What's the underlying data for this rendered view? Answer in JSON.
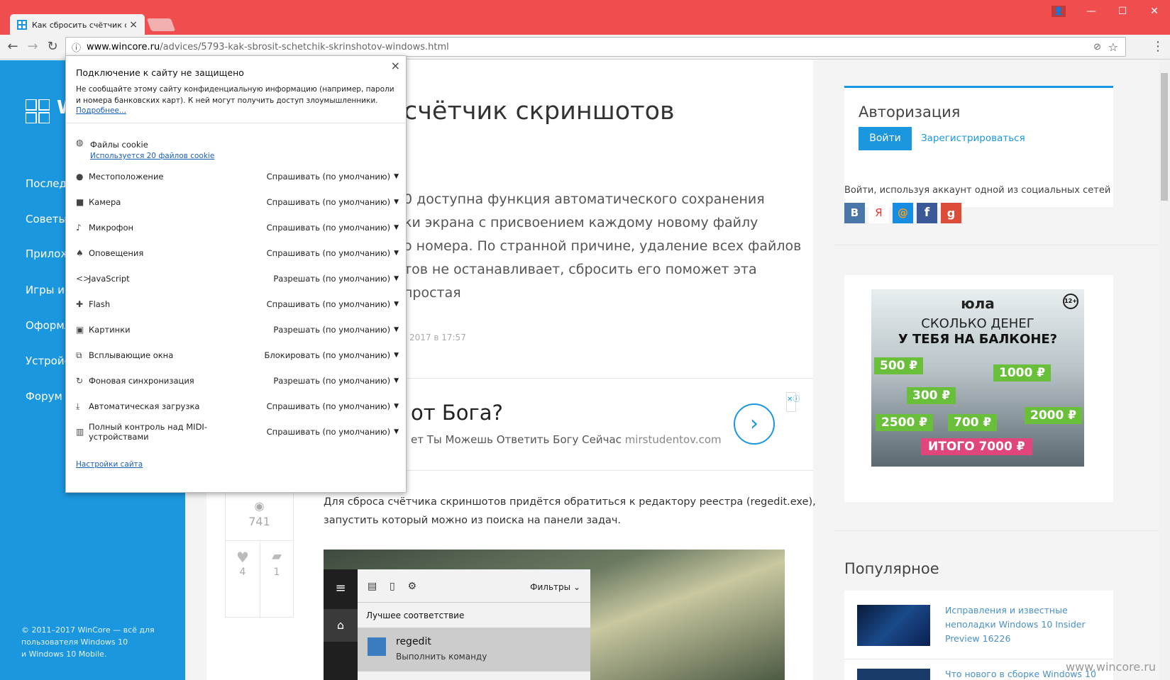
{
  "browser": {
    "tab_title": "Как сбросить счётчик с",
    "tab_close": "×",
    "url_domain": "www.wincore.ru",
    "url_path": "/advices/5793-kak-sbrosit-schetchik-skrinshotov-windows.html",
    "back": "←",
    "forward": "→",
    "reload": "↻",
    "info": "ⓘ",
    "star": "☆",
    "menu": "⋮",
    "min": "—",
    "max": "☐",
    "close": "✕",
    "user": "👤",
    "ext": "⊘"
  },
  "sidebar": {
    "logo_letter": "W",
    "items": [
      "Последн",
      "Советы и",
      "Приложе",
      "Игры и р",
      "Оформл",
      "Устройс",
      "Форум о"
    ],
    "footer": [
      "© 2011–2017 WinCore — всё для",
      "пользователя Windows 10",
      "и Windows 10 Mobile."
    ]
  },
  "article": {
    "title": "счётчик скриншотов",
    "lead": [
      "0 доступна функция автоматического сохранения",
      "ки экрана с присвоением каждому новому файлу",
      "о номера. По странной причине, удаление всех файлов",
      "тов не останавливает, сбросить его поможет эта простая"
    ],
    "date": "2017 в 17:57",
    "ad_title": "от Бога?",
    "ad_text": "ет Ты Можешь Ответить Богу Сейчас",
    "ad_domain": "mirstudentov.com",
    "views": "741",
    "likes": "4",
    "comments": "1",
    "body": [
      "Для сброса счётчика скриншотов придётся обратиться к редактору реестра (regedit.exe),",
      "запустить который можно из поиска на панели задач."
    ],
    "search_filters": "Фильтры",
    "search_best": "Лучшее соответствие",
    "search_app": "regedit",
    "search_app_sub": "Выполнить команду"
  },
  "right": {
    "auth_title": "Авторизация",
    "login_btn": "Войти",
    "register_link": "Зарегистрироваться",
    "social_text": "Войти, используя аккаунт одной из социальных сетей",
    "socials": [
      {
        "l": "В",
        "c": "#4a76a8"
      },
      {
        "l": "Я",
        "c": "#fff"
      },
      {
        "l": "@",
        "c": "#168de2"
      },
      {
        "l": "f",
        "c": "#3b5998"
      },
      {
        "l": "g",
        "c": "#dd4b39"
      }
    ],
    "ad_brand": "юла",
    "ad_line1": "СКОЛЬКО ДЕНЕГ",
    "ad_line2": "У ТЕБЯ НА БАЛКОНЕ?",
    "ad_prices": [
      "500 ₽",
      "1000 ₽",
      "300 ₽",
      "2000 ₽",
      "2500 ₽",
      "700 ₽"
    ],
    "ad_total": "ИТОГО 7000 ₽",
    "ad_age": "12+",
    "popular_title": "Популярное",
    "popular_items": [
      "Исправления и известные",
      "неполадки Windows 10 Insider",
      "Preview 16226"
    ],
    "popular_next": "Что нового в сборке Windows 10",
    "watermark": "www.wincore.ru"
  },
  "popup": {
    "title": "Подключение к сайту не защищено",
    "warn": "Не сообщайте этому сайту конфиденциальную информацию (например, пароли и номера банковских карт). К ней могут получить доступ злоумышленники.",
    "more": "Подробнее...",
    "close": "×",
    "cookies_label": "Файлы cookie",
    "cookies_link": "Используется 20 файлов cookie",
    "permissions": [
      {
        "icon": "●",
        "label": "Местоположение",
        "value": "Спрашивать (по умолчанию)"
      },
      {
        "icon": "■",
        "label": "Камера",
        "value": "Спрашивать (по умолчанию)"
      },
      {
        "icon": "♪",
        "label": "Микрофон",
        "value": "Спрашивать (по умолчанию)"
      },
      {
        "icon": "♠",
        "label": "Оповещения",
        "value": "Спрашивать (по умолчанию)"
      },
      {
        "icon": "<>",
        "label": "JavaScript",
        "value": "Разрешать (по умолчанию)"
      },
      {
        "icon": "✚",
        "label": "Flash",
        "value": "Спрашивать (по умолчанию)"
      },
      {
        "icon": "▣",
        "label": "Картинки",
        "value": "Разрешать (по умолчанию)"
      },
      {
        "icon": "⧉",
        "label": "Всплывающие окна",
        "value": "Блокировать (по умолчанию)"
      },
      {
        "icon": "↻",
        "label": "Фоновая синхронизация",
        "value": "Разрешать (по умолчанию)"
      },
      {
        "icon": "⤓",
        "label": "Автоматическая загрузка",
        "value": "Спрашивать (по умолчанию)"
      },
      {
        "icon": "▥",
        "label": "Полный контроль над MIDI-устройствами",
        "value": "Спрашивать (по умолчанию)"
      }
    ],
    "settings_link": "Настройки сайта"
  }
}
